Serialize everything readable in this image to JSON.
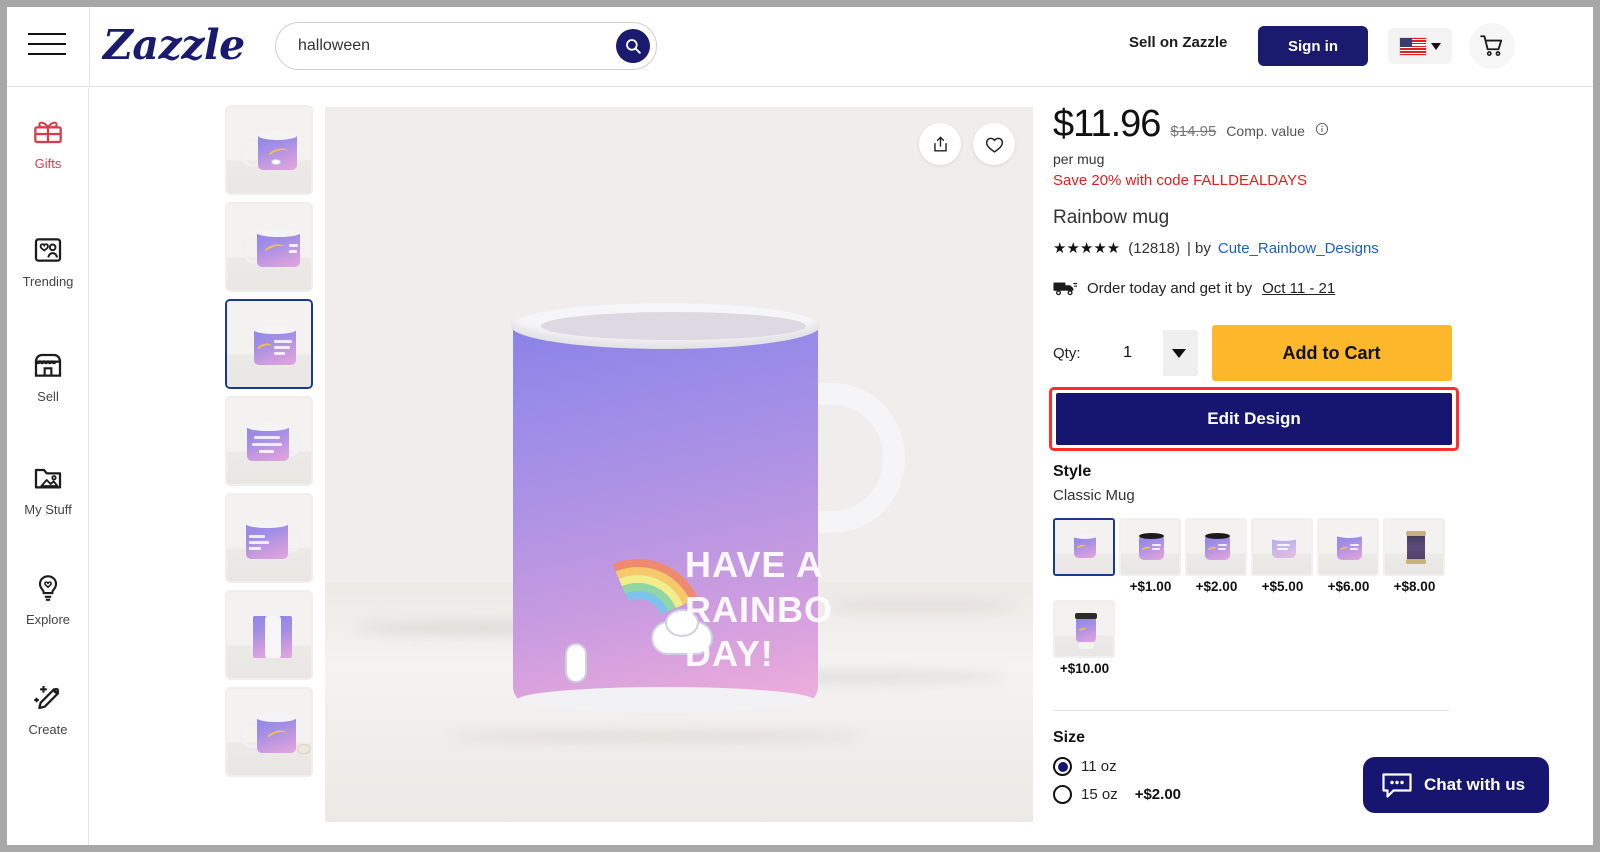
{
  "header": {
    "logo": "Zazzle",
    "menu_icon": "hamburger-icon",
    "search": {
      "value": "halloween",
      "placeholder": "Search"
    },
    "sell_on_zazzle": "Sell on Zazzle",
    "sign_in": "Sign in",
    "locale_flag": "us-flag",
    "cart_icon": "cart-icon"
  },
  "sidebar": {
    "items": [
      {
        "label": "Gifts",
        "icon": "gift-icon",
        "active": true
      },
      {
        "label": "Trending",
        "icon": "trending-icon",
        "active": false
      },
      {
        "label": "Sell",
        "icon": "storefront-icon",
        "active": false
      },
      {
        "label": "My Stuff",
        "icon": "folder-image-icon",
        "active": false
      },
      {
        "label": "Explore",
        "icon": "lightbulb-heart-icon",
        "active": false
      },
      {
        "label": "Create",
        "icon": "pencil-sparkle-icon",
        "active": false
      }
    ]
  },
  "gallery": {
    "selected_index": 2,
    "thumb_count": 7,
    "share_icon": "share-icon",
    "favorite_icon": "heart-icon",
    "hero_text_line1": "HAVE A",
    "hero_text_line2": "RAINBO",
    "hero_text_line3": "DAY!"
  },
  "product": {
    "price": "$11.96",
    "comp_price": "$14.95",
    "comp_label": "Comp. value",
    "info_icon": "info-icon",
    "per_unit": "per mug",
    "promo": "Save 20% with code FALLDEALDAYS",
    "title": "Rainbow mug",
    "stars": "★★★★★",
    "review_count": "(12818)",
    "by_separator": "| by",
    "designer": "Cute_Rainbow_Designs",
    "delivery_icon": "truck-icon",
    "delivery_text": "Order today and get it by",
    "delivery_date": "Oct 11 - 21"
  },
  "buy": {
    "qty_label": "Qty:",
    "qty_value": "1",
    "add_to_cart": "Add to Cart",
    "edit_design": "Edit Design",
    "highlight_color": "#ff2d2d"
  },
  "style": {
    "title": "Style",
    "selected": "Classic Mug",
    "options": [
      {
        "price": "",
        "selected": true,
        "kind": "classic-white"
      },
      {
        "price": "+$1.00",
        "selected": false,
        "kind": "black-rim"
      },
      {
        "price": "+$2.00",
        "selected": false,
        "kind": "black-rim"
      },
      {
        "price": "+$5.00",
        "selected": false,
        "kind": "light-mug"
      },
      {
        "price": "+$6.00",
        "selected": false,
        "kind": "classic-white"
      },
      {
        "price": "+$8.00",
        "selected": false,
        "kind": "dark-tumbler"
      },
      {
        "price": "+$10.00",
        "selected": false,
        "kind": "travel-mug"
      }
    ]
  },
  "size": {
    "title": "Size",
    "options": [
      {
        "label": "11 oz",
        "extra": "",
        "selected": true
      },
      {
        "label": "15 oz",
        "extra": "+$2.00",
        "selected": false
      }
    ]
  },
  "chat": {
    "label": "Chat with us",
    "icon": "chat-bubble-icon"
  }
}
